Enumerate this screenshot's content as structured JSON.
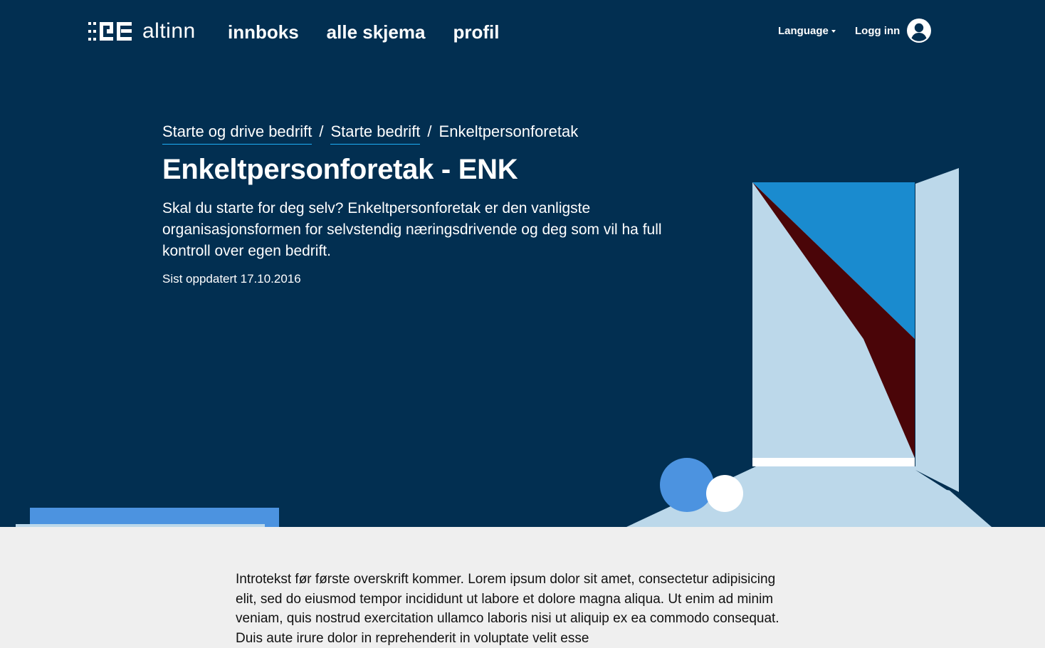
{
  "header": {
    "logo_text": "altinn",
    "nav": [
      {
        "label": "innboks"
      },
      {
        "label": "alle skjema"
      },
      {
        "label": "profil"
      }
    ],
    "language_label": "Language",
    "login_label": "Logg inn"
  },
  "breadcrumb": [
    {
      "label": "Starte og drive bedrift"
    },
    {
      "label": "Starte bedrift"
    },
    {
      "label": "Enkeltpersonforetak"
    }
  ],
  "breadcrumb_separator": "/",
  "page": {
    "title": "Enkeltpersonforetak - ENK",
    "ingress": "Skal du starte for deg selv? Enkeltpersonforetak er den vanligste organisasjonsformen for selvstendig næringsdrivende og deg som vil ha full kontroll over egen bedrift.",
    "updated": "Sist oppdatert 17.10.2016"
  },
  "content": {
    "intro": "Introtekst før første overskrift kommer. Lorem ipsum dolor sit amet, consectetur adipisicing elit, sed do eiusmod tempor incididunt ut labore et dolore magna aliqua. Ut enim ad minim veniam, quis nostrud exercitation ullamco laboris nisi ut aliquip ex ea commodo consequat. Duis aute irure dolor in reprehenderit in voluptate velit esse"
  },
  "colors": {
    "hero_bg": "#022f51",
    "page_bg": "#efefef",
    "link_underline": "#1eaef7",
    "accent_blue": "#1a8bcf",
    "light_blue": "#bcd8ea",
    "dark_red": "#4a0508"
  },
  "icons": {
    "logo": "altinn-logo-icon",
    "caret": "caret-down-icon",
    "avatar": "user-avatar-icon"
  }
}
